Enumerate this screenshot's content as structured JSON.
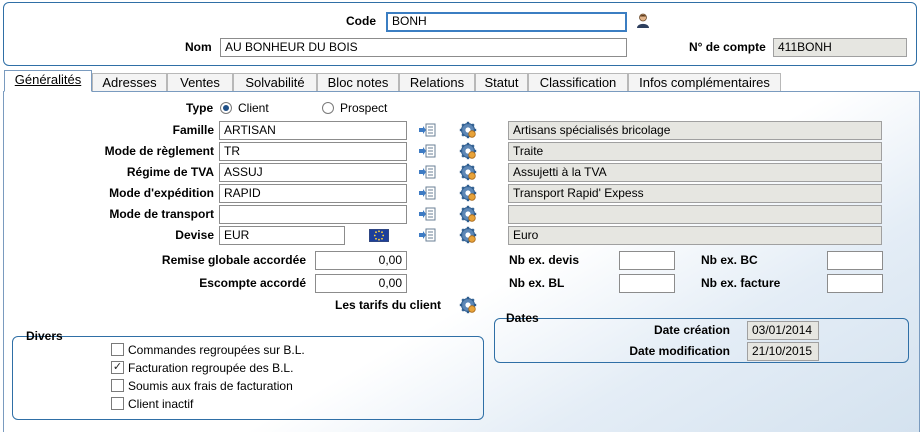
{
  "header": {
    "code_label": "Code",
    "code_value": "BONH",
    "nom_label": "Nom",
    "nom_value": "AU BONHEUR DU BOIS",
    "compte_label": "N° de compte",
    "compte_value": "411BONH"
  },
  "tabs": [
    {
      "label": "Généralités",
      "active": true
    },
    {
      "label": "Adresses"
    },
    {
      "label": "Ventes"
    },
    {
      "label": "Solvabilité"
    },
    {
      "label": "Bloc notes"
    },
    {
      "label": "Relations"
    },
    {
      "label": "Statut"
    },
    {
      "label": "Classification"
    },
    {
      "label": "Infos complémentaires"
    }
  ],
  "type": {
    "label": "Type",
    "client_label": "Client",
    "prospect_label": "Prospect",
    "selected": "Client"
  },
  "fields": {
    "famille": {
      "label": "Famille",
      "code": "ARTISAN",
      "desc": "Artisans spécialisés bricolage"
    },
    "reglement": {
      "label": "Mode de règlement",
      "code": "TR",
      "desc": "Traite"
    },
    "tva": {
      "label": "Régime de TVA",
      "code": "ASSUJ",
      "desc": "Assujetti à la TVA"
    },
    "expedition": {
      "label": "Mode d'expédition",
      "code": "RAPID",
      "desc": "Transport Rapid' Expess"
    },
    "transport": {
      "label": "Mode de transport",
      "code": "",
      "desc": ""
    },
    "devise": {
      "label": "Devise",
      "code": "EUR",
      "desc": "Euro"
    }
  },
  "remise": {
    "label": "Remise globale accordée",
    "value": "0,00"
  },
  "escompte": {
    "label": "Escompte accordé",
    "value": "0,00"
  },
  "tarifs_label": "Les tarifs du client",
  "copies": {
    "devis_label": "Nb ex. devis",
    "devis_value": "",
    "bc_label": "Nb ex. BC",
    "bc_value": "",
    "bl_label": "Nb ex. BL",
    "bl_value": "",
    "facture_label": "Nb ex. facture",
    "facture_value": ""
  },
  "divers": {
    "title": "Divers",
    "items": [
      {
        "label": "Commandes regroupées sur B.L.",
        "checked": false
      },
      {
        "label": "Facturation regroupée des B.L.",
        "checked": true
      },
      {
        "label": "Soumis aux frais de facturation",
        "checked": false
      },
      {
        "label": "Client inactif",
        "checked": false
      }
    ]
  },
  "dates": {
    "title": "Dates",
    "creation_label": "Date création",
    "creation_value": "03/01/2014",
    "modification_label": "Date modification",
    "modification_value": "21/10/2015"
  },
  "icons": {
    "person": "person-icon",
    "list": "list-arrow-icon",
    "gear": "gear-icon",
    "flag": "eu-flag-icon"
  },
  "colors": {
    "accent": "#2f6fa6",
    "readonly_bg": "#e6e6e1",
    "focus_border": "#3b7ec2"
  }
}
